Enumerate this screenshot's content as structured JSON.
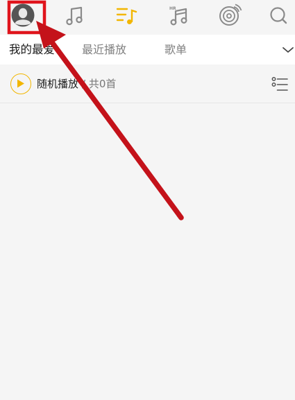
{
  "colors": {
    "accent": "#f2b600",
    "icon_gray": "#8a8a8a",
    "annotation_red": "#c4121a"
  },
  "nav": {
    "icons": [
      "avatar-icon",
      "music-note-icon",
      "playlist-icon",
      "hr-music-icon",
      "radio-disc-icon",
      "search-icon"
    ],
    "hr_badge": "HR"
  },
  "tabs": {
    "items": [
      {
        "label": "我的最爱"
      },
      {
        "label": "最近播放"
      },
      {
        "label": "歌单"
      }
    ]
  },
  "playbar": {
    "play_label": "随机播放",
    "count_label": "/ 共0首"
  }
}
